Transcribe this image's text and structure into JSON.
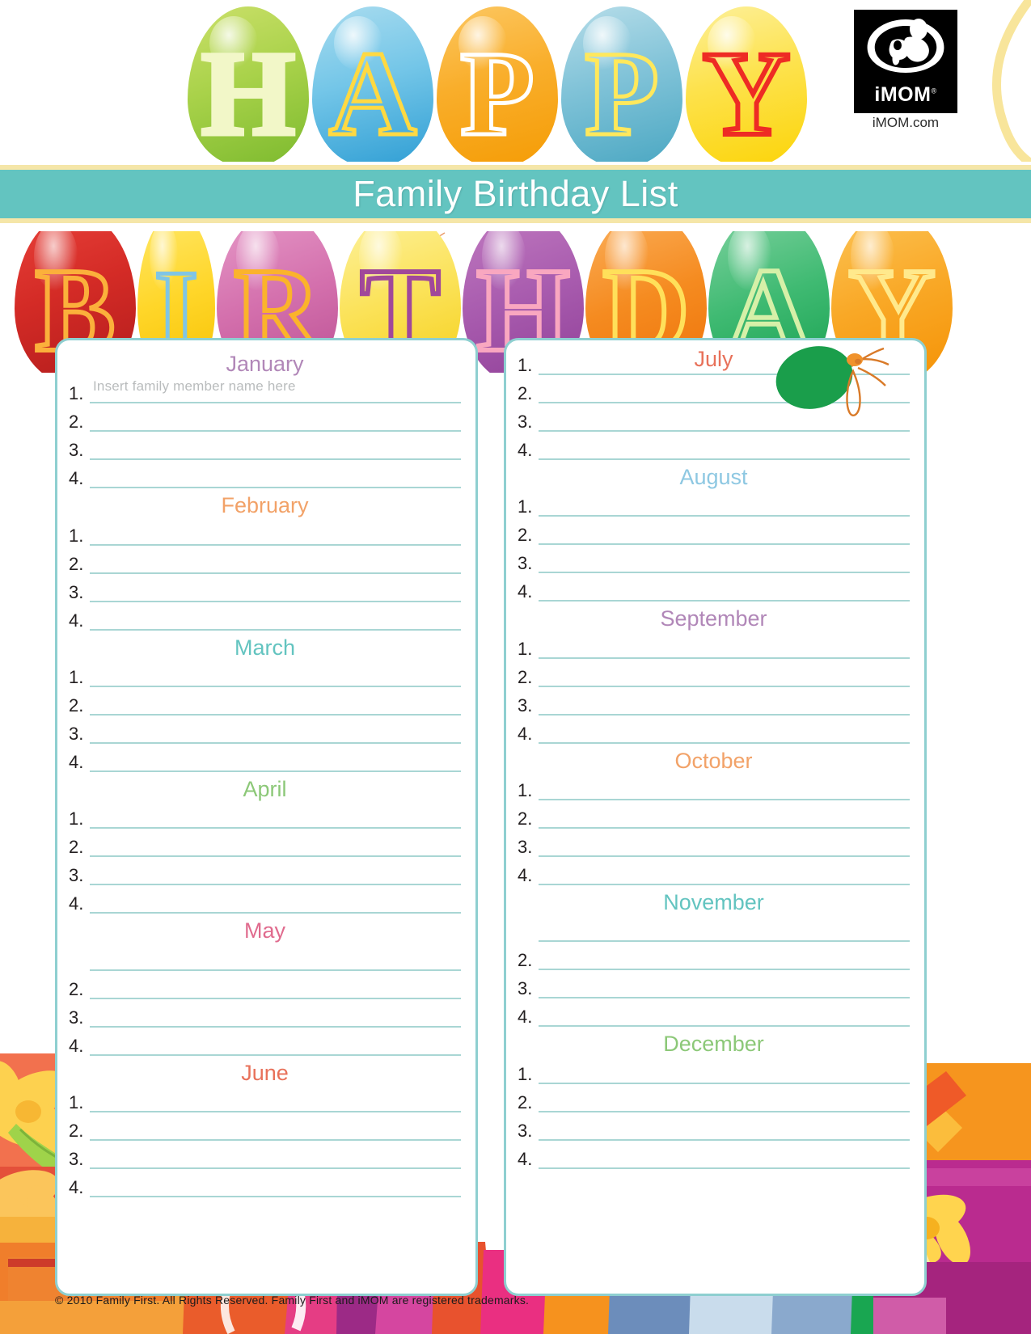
{
  "header": {
    "happy_word": "HAPPY",
    "happy_letters": [
      "H",
      "A",
      "P",
      "P",
      "Y"
    ],
    "birthday_word": "BIRTHDAY",
    "birthday_letters": [
      "B",
      "I",
      "R",
      "T",
      "H",
      "D",
      "A",
      "Y"
    ],
    "title": "Family Birthday List",
    "logo": {
      "wordmark": "iMOM",
      "registered": "®",
      "site": "iMOM.com"
    }
  },
  "placeholder": "Insert family member name here",
  "numbers": [
    "1.",
    "2.",
    "3.",
    "4."
  ],
  "colors": {
    "title_bar": "#63c4c0",
    "title_bar_edge": "#f5e6a8",
    "card_border": "#8ecfd0",
    "rule": "#a9d6d4",
    "number": "#231f20",
    "placeholder": "#b9bcbd"
  },
  "columns": [
    {
      "id": "left",
      "months": [
        {
          "name": "January",
          "color": "#b187b8",
          "class": "m-jan",
          "lines": [
            "1.",
            "2.",
            "3.",
            "4."
          ],
          "first_line_placeholder": true
        },
        {
          "name": "February",
          "color": "#f2a268",
          "class": "m-feb",
          "lines": [
            "1.",
            "2.",
            "3.",
            "4."
          ],
          "first_line_placeholder": false
        },
        {
          "name": "March",
          "color": "#63c4c0",
          "class": "m-mar",
          "lines": [
            "1.",
            "2.",
            "3.",
            "4."
          ],
          "first_line_placeholder": false
        },
        {
          "name": "April",
          "color": "#8cc878",
          "class": "m-apr",
          "lines": [
            "1.",
            "2.",
            "3.",
            "4."
          ],
          "first_line_placeholder": false
        },
        {
          "name": "May",
          "color": "#e06b8e",
          "class": "m-may",
          "lines": [
            "",
            "2.",
            "3.",
            "4."
          ],
          "first_line_placeholder": false
        },
        {
          "name": "June",
          "color": "#e8715a",
          "class": "m-jun",
          "lines": [
            "1.",
            "2.",
            "3.",
            "4."
          ],
          "first_line_placeholder": false
        }
      ]
    },
    {
      "id": "right",
      "months": [
        {
          "name": "July",
          "color": "#e8715a",
          "class": "m-jul",
          "lines": [
            "1.",
            "2.",
            "3.",
            "4."
          ],
          "first_line_placeholder": false
        },
        {
          "name": "August",
          "color": "#8ec8e2",
          "class": "m-aug",
          "lines": [
            "1.",
            "2.",
            "3.",
            "4."
          ],
          "first_line_placeholder": false
        },
        {
          "name": "September",
          "color": "#b187b8",
          "class": "m-sep",
          "lines": [
            "1.",
            "2.",
            "3.",
            "4."
          ],
          "first_line_placeholder": false
        },
        {
          "name": "October",
          "color": "#f2a268",
          "class": "m-oct",
          "lines": [
            "1.",
            "2.",
            "3.",
            "4."
          ],
          "first_line_placeholder": false
        },
        {
          "name": "November",
          "color": "#63c4c0",
          "class": "m-nov",
          "lines": [
            "",
            "2.",
            "3.",
            "4."
          ],
          "first_line_placeholder": false
        },
        {
          "name": "December",
          "color": "#8cc878",
          "class": "m-dec",
          "lines": [
            "1.",
            "2.",
            "3.",
            "4."
          ],
          "first_line_placeholder": false
        }
      ]
    }
  ],
  "footer": {
    "copyright": "© 2010 Family First. All Rights Reserved. Family First and iMOM are registered trademarks."
  }
}
